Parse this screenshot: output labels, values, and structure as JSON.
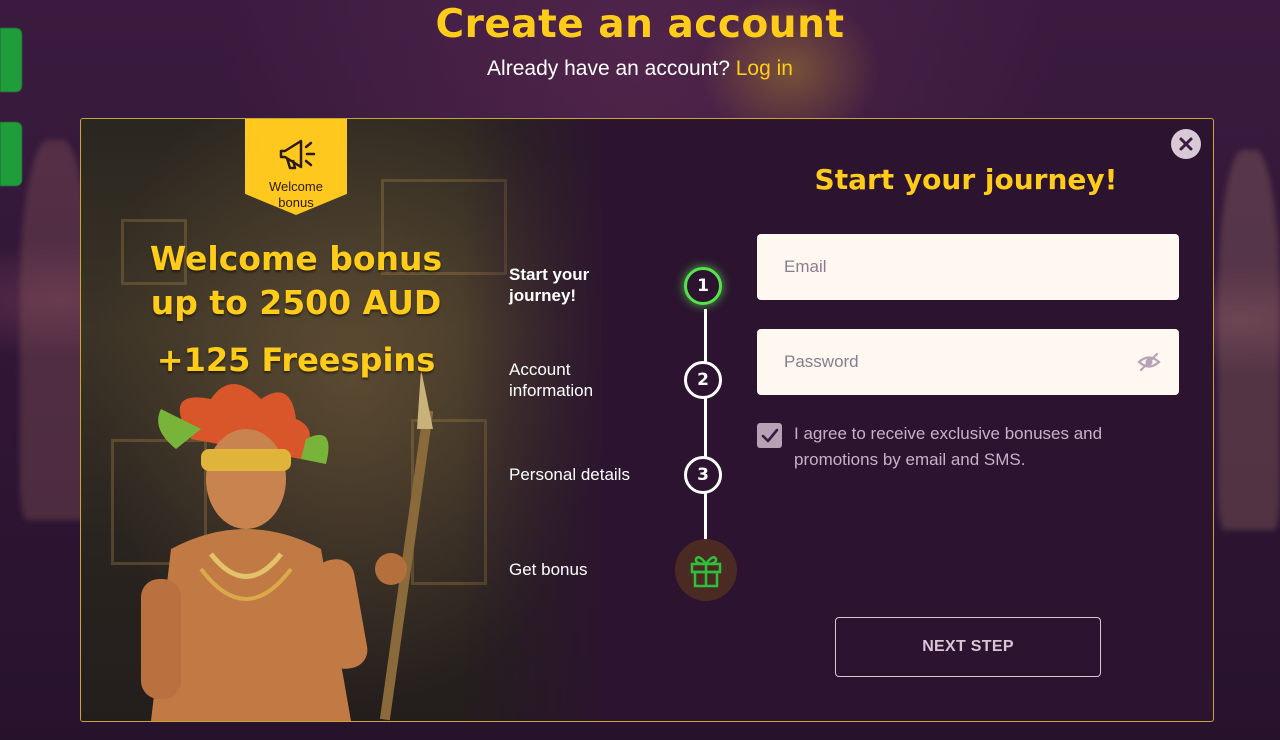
{
  "header": {
    "title": "Create an account",
    "login_prompt": "Already have an account?",
    "login_link": "Log in"
  },
  "promo": {
    "tag_label_line1": "Welcome",
    "tag_label_line2": "bonus",
    "headline_line1": "Welcome bonus",
    "headline_line2": "up to 2500 AUD",
    "freespins": "+125 Freespins"
  },
  "steps": [
    {
      "label_line1": "Start your",
      "label_line2": "journey!",
      "number": "1",
      "state": "active"
    },
    {
      "label_line1": "Account",
      "label_line2": "information",
      "number": "2",
      "state": "pending"
    },
    {
      "label_line1": "Personal details",
      "label_line2": "",
      "number": "3",
      "state": "pending"
    },
    {
      "label_line1": "Get bonus",
      "label_line2": "",
      "number": "",
      "state": "gift"
    }
  ],
  "form": {
    "title": "Start your journey!",
    "email_placeholder": "Email",
    "email_value": "",
    "password_placeholder": "Password",
    "password_value": "",
    "consent_checked": true,
    "consent_text": "I agree to receive exclusive bonuses and promotions by email and SMS.",
    "next_label": "NEXT STEP"
  },
  "icons": {
    "tag_icon": "megaphone-icon",
    "close": "close-icon",
    "password_toggle": "eye-slash-icon",
    "checkbox": "check-icon",
    "bonus_step": "gift-icon"
  },
  "colors": {
    "accent_yellow": "#ffcc1a",
    "active_step_green": "#55e24b",
    "modal_bg": "#2c1330",
    "field_bg": "#fff8f0"
  }
}
